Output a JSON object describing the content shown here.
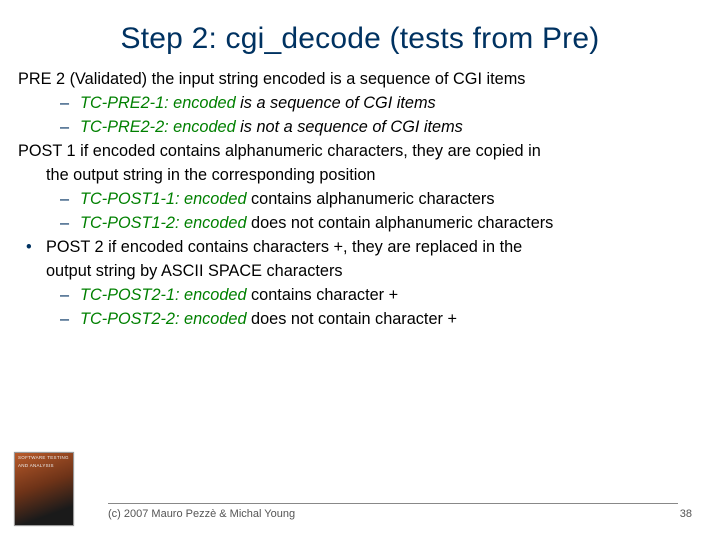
{
  "title": "Step 2: cgi_decode (tests from Pre)",
  "pre2": {
    "lead": "PRE 2 (Validated) the input string encoded is a sequence of CGI items",
    "tc1_label": "TC-PRE2-1: encoded",
    "tc1_rest": " is a sequence of CGI items",
    "tc2_label": "TC-PRE2-2: encoded",
    "tc2_rest": " is not a sequence of CGI items"
  },
  "post1": {
    "lead_a": "POST 1 if encoded contains alphanumeric characters, they are copied in",
    "lead_b": "the output string in the corresponding position",
    "tc1_label": "TC-POST1-1: encoded",
    "tc1_rest": " contains alphanumeric characters",
    "tc2_label": "TC-POST1-2: encoded",
    "tc2_rest": " does not contain alphanumeric characters"
  },
  "post2": {
    "lead_a": "POST 2 if encoded contains characters +, they are replaced in the",
    "lead_b": "output string by ASCII SPACE characters",
    "tc1_label": "TC-POST2-1: encoded",
    "tc1_rest": " contains character +",
    "tc2_label": "TC-POST2-2: encoded",
    "tc2_rest": " does not contain character +"
  },
  "footer": {
    "copyright": "(c) 2007 Mauro Pezzè & Michal Young",
    "page": "38"
  },
  "book": {
    "line1": "SOFTWARE TESTING",
    "line2": "AND ANALYSIS"
  }
}
